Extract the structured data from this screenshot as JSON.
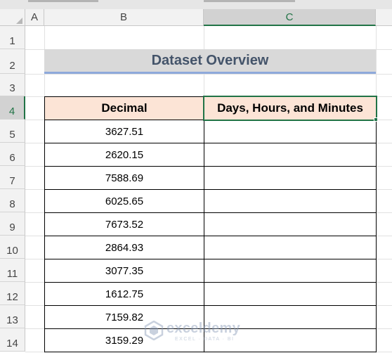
{
  "columns": {
    "a": "A",
    "b": "B",
    "c": "C"
  },
  "rows": [
    "1",
    "2",
    "3",
    "4",
    "5",
    "6",
    "7",
    "8",
    "9",
    "10",
    "11",
    "12",
    "13",
    "14"
  ],
  "active_column": "C",
  "active_row": "4",
  "title": "Dataset Overview",
  "table": {
    "headers": [
      "Decimal",
      "Days, Hours, and Minutes"
    ],
    "decimal_values": [
      "3627.51",
      "2620.15",
      "7588.69",
      "6025.65",
      "7673.52",
      "2864.93",
      "3077.35",
      "1612.75",
      "7159.82",
      "3159.29"
    ],
    "result_values": [
      "",
      "",
      "",
      "",
      "",
      "",
      "",
      "",
      "",
      ""
    ]
  },
  "watermark": {
    "name": "exceldemy",
    "tagline": "EXCEL · DATA · BI"
  },
  "colors": {
    "accent": "#217346",
    "title_text": "#44546a",
    "header_fill": "#fce4d6",
    "banner_fill": "#d9d9d9",
    "banner_underline": "#8ea9db"
  }
}
